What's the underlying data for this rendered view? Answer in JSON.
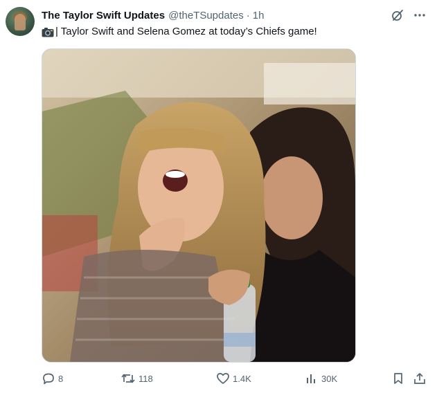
{
  "tweet": {
    "author_name": "The Taylor Swift Updates",
    "handle": "@theTSupdates",
    "separator": "·",
    "time": "1h",
    "text": "| Taylor Swift and Selena Gomez at today’s Chiefs game!",
    "leading_emoji": "camera-icon"
  },
  "header_icons": [
    "grok-icon",
    "more-icon"
  ],
  "media": {
    "kind": "photo"
  },
  "actions": {
    "replies": "8",
    "reposts": "118",
    "likes": "1.4K",
    "views": "30K"
  },
  "action_icons": [
    "reply-icon",
    "repost-icon",
    "like-icon",
    "views-icon",
    "bookmark-icon",
    "share-icon"
  ],
  "colors": {
    "text": "#0f1419",
    "secondary": "#536471",
    "border": "#cfd9de"
  }
}
